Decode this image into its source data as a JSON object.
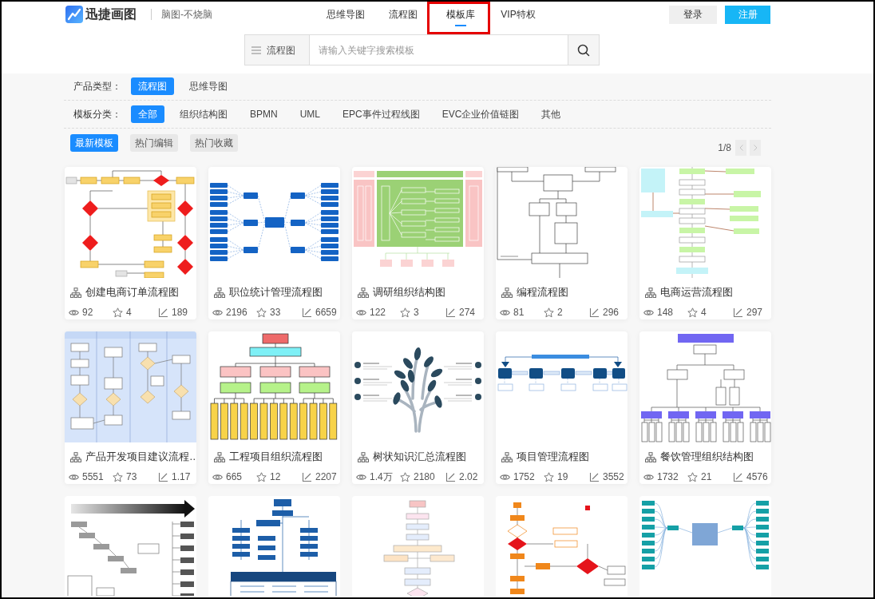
{
  "header": {
    "logo": "迅捷画图",
    "slogan": "脑图-不烧脑",
    "nav": [
      {
        "label": "思维导图",
        "selected": false,
        "highlighted": false
      },
      {
        "label": "流程图",
        "selected": false,
        "highlighted": false
      },
      {
        "label": "模板库",
        "selected": true,
        "highlighted": true
      },
      {
        "label": "VIP特权",
        "selected": false,
        "highlighted": false
      }
    ],
    "buttons": [
      {
        "label": "登录",
        "kind": "secondary"
      },
      {
        "label": "注册",
        "kind": "primary"
      }
    ]
  },
  "search": {
    "category": "流程图",
    "placeholder": "请输入关键字搜索模板"
  },
  "filters": [
    {
      "label": "产品类型：",
      "options": [
        {
          "label": "流程图",
          "selected": true
        },
        {
          "label": "思维导图",
          "selected": false
        }
      ]
    },
    {
      "label": "模板分类：",
      "options": [
        {
          "label": "全部",
          "selected": true
        },
        {
          "label": "组织结构图",
          "selected": false
        },
        {
          "label": "BPMN",
          "selected": false
        },
        {
          "label": "UML",
          "selected": false
        },
        {
          "label": "EPC事件过程线图",
          "selected": false
        },
        {
          "label": "EVC企业价值链图",
          "selected": false
        },
        {
          "label": "其他",
          "selected": false
        }
      ]
    }
  ],
  "sort_tabs": [
    {
      "label": "最新模板",
      "selected": true
    },
    {
      "label": "热门编辑",
      "selected": false
    },
    {
      "label": "热门收藏",
      "selected": false
    }
  ],
  "pagination": {
    "page": "1/8"
  },
  "cards": [
    {
      "kind": "flowchart",
      "title": "创建电商订单流程图",
      "views": "92",
      "favorites": "4",
      "uses": "189"
    },
    {
      "kind": "mindmap",
      "title": "职位统计管理流程图",
      "views": "2196",
      "favorites": "33",
      "uses": "6659"
    },
    {
      "kind": "blocks",
      "title": "调研组织结构图",
      "views": "122",
      "favorites": "3",
      "uses": "274"
    },
    {
      "kind": "outline",
      "title": "编程流程图",
      "views": "81",
      "favorites": "2",
      "uses": "296"
    },
    {
      "kind": "process",
      "title": "电商运营流程图",
      "views": "148",
      "favorites": "4",
      "uses": "297"
    },
    {
      "kind": "swimlane",
      "title": "产品开发项目建议流程…",
      "views": "5551",
      "favorites": "73",
      "uses": "1.17"
    },
    {
      "kind": "org",
      "title": "工程项目组织流程图",
      "views": "665",
      "favorites": "12",
      "uses": "2207"
    },
    {
      "kind": "tree",
      "title": "树状知识汇总流程图",
      "views": "1.4万",
      "favorites": "2180",
      "uses": "2.02"
    },
    {
      "kind": "chain",
      "title": "项目管理流程图",
      "views": "1752",
      "favorites": "19",
      "uses": "3552"
    },
    {
      "kind": "org2",
      "title": "餐饮管理组织结构图",
      "views": "1732",
      "favorites": "21",
      "uses": "4576"
    },
    {
      "kind": "steps"
    },
    {
      "kind": "org_blue"
    },
    {
      "kind": "flow_light"
    },
    {
      "kind": "flow_orange"
    },
    {
      "kind": "mind_teal"
    }
  ]
}
